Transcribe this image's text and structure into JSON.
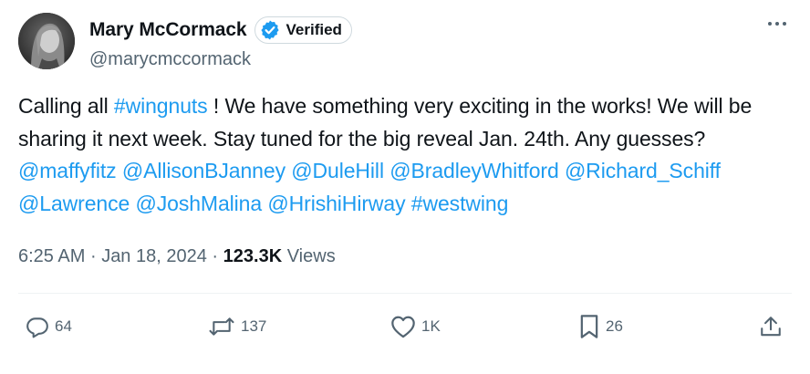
{
  "author": {
    "display_name": "Mary McCormack",
    "verified_label": "Verified",
    "handle": "@marycmccormack"
  },
  "tweet": {
    "segments": [
      {
        "text": "Calling all ",
        "type": "text"
      },
      {
        "text": "#wingnuts",
        "type": "link"
      },
      {
        "text": " ! We have something very exciting in the works! We will be sharing it next week. Stay tuned for the big reveal Jan. 24th. Any guesses? ",
        "type": "text"
      },
      {
        "text": "@maffyfitz",
        "type": "link"
      },
      {
        "text": " ",
        "type": "text"
      },
      {
        "text": "@AllisonBJanney",
        "type": "link"
      },
      {
        "text": " ",
        "type": "text"
      },
      {
        "text": "@DuleHill",
        "type": "link"
      },
      {
        "text": " ",
        "type": "text"
      },
      {
        "text": "@BradleyWhitford",
        "type": "link"
      },
      {
        "text": " ",
        "type": "text"
      },
      {
        "text": "@Richard_Schiff",
        "type": "link"
      },
      {
        "text": " ",
        "type": "text"
      },
      {
        "text": "@Lawrence",
        "type": "link"
      },
      {
        "text": " ",
        "type": "text"
      },
      {
        "text": "@JoshMalina",
        "type": "link"
      },
      {
        "text": " ",
        "type": "text"
      },
      {
        "text": "@HrishiHirway",
        "type": "link"
      },
      {
        "text": " ",
        "type": "text"
      },
      {
        "text": "#westwing",
        "type": "link"
      }
    ]
  },
  "meta": {
    "time": "6:25 AM",
    "separator": "·",
    "date": "Jan 18, 2024",
    "views_count": "123.3K",
    "views_label": "Views"
  },
  "actions": {
    "replies": "64",
    "reposts": "137",
    "likes": "1K",
    "bookmarks": "26"
  },
  "icons": {
    "reply": "reply-icon",
    "repost": "repost-icon",
    "like": "heart-icon",
    "bookmark": "bookmark-icon",
    "share": "share-icon",
    "more": "more-dots-icon",
    "verified": "verified-badge-icon"
  },
  "colors": {
    "link": "#1d9bf0",
    "secondary_text": "#536471",
    "primary_text": "#0f1419",
    "divider": "#eff3f4"
  }
}
